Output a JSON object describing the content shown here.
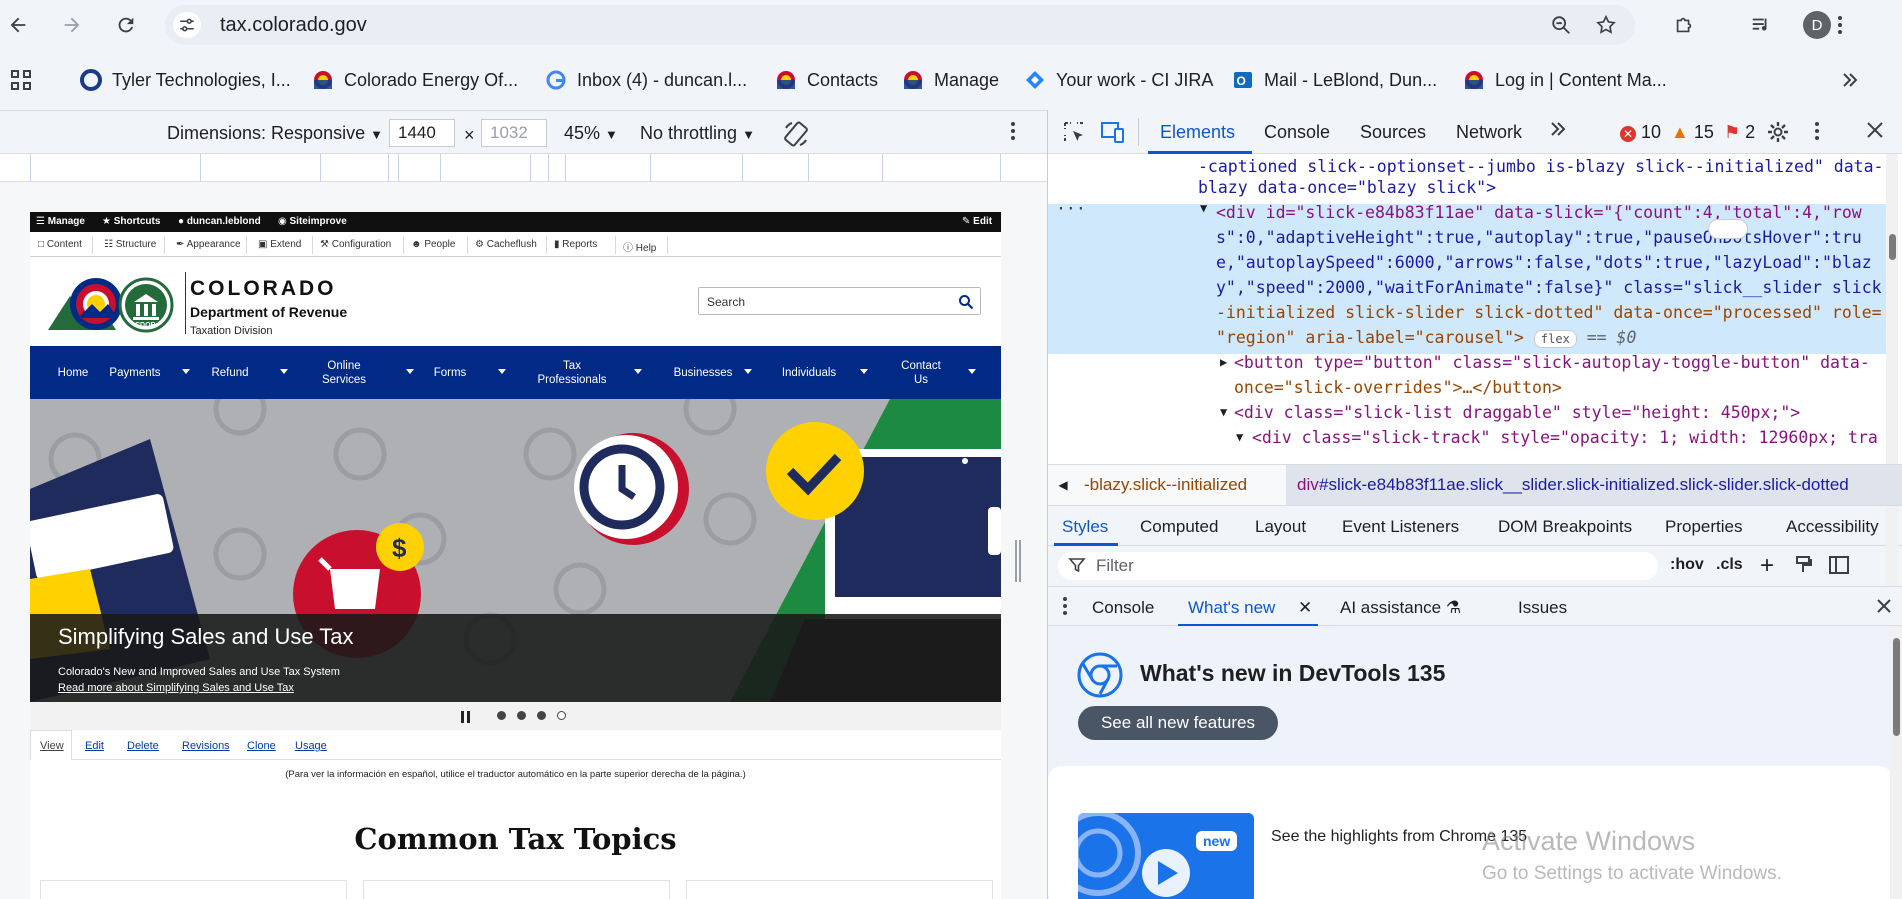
{
  "browser": {
    "url": "tax.colorado.gov",
    "avatar_letter": "D",
    "bookmarks": [
      {
        "label": "Tyler Technologies, I...",
        "icon": "tyler-favicon"
      },
      {
        "label": "Colorado Energy Of...",
        "icon": "colorado-favicon"
      },
      {
        "label": "Inbox (4) - duncan.l...",
        "icon": "google-favicon"
      },
      {
        "label": "Contacts",
        "icon": "colorado-favicon"
      },
      {
        "label": "Manage",
        "icon": "colorado-favicon"
      },
      {
        "label": "Your work - CI JIRA",
        "icon": "jira-favicon"
      },
      {
        "label": "Mail - LeBlond, Dun...",
        "icon": "outlook-favicon"
      },
      {
        "label": "Log in | Content Ma...",
        "icon": "colorado-favicon"
      }
    ]
  },
  "device_toolbar": {
    "dimensions_label": "Dimensions: Responsive",
    "width": "1440",
    "x_sep": "×",
    "height_placeholder": "1032",
    "zoom": "45%",
    "throttling": "No throttling"
  },
  "site": {
    "admin_bar": {
      "manage": "Manage",
      "shortcuts": "Shortcuts",
      "user": "duncan.leblond",
      "siteimprove": "Siteimprove",
      "edit": "Edit"
    },
    "admin_tools": [
      "Content",
      "Structure",
      "Appearance",
      "Extend",
      "Configuration",
      "People",
      "Cacheflush",
      "Reports",
      "Help"
    ],
    "header": {
      "state": "COLORADO",
      "department": "Department of Revenue",
      "division": "Taxation Division",
      "logo_badge": "CDOR",
      "search_placeholder": "Search"
    },
    "nav": [
      {
        "label": "Home",
        "has_caret": false
      },
      {
        "label": "Payments",
        "has_caret": true
      },
      {
        "label": "Refund",
        "has_caret": true
      },
      {
        "label": "Online Services",
        "has_caret": true
      },
      {
        "label": "Forms",
        "has_caret": true
      },
      {
        "label": "Tax Professionals",
        "has_caret": true
      },
      {
        "label": "Businesses",
        "has_caret": true
      },
      {
        "label": "Individuals",
        "has_caret": true
      },
      {
        "label": "Contact Us",
        "has_caret": true
      }
    ],
    "hero": {
      "title": "Simplifying Sales and Use Tax",
      "subtitle": "Colorado's New and Improved Sales and Use Tax System",
      "link": "Read more about Simplifying Sales and Use Tax",
      "slide_count": 4,
      "active_slide": 4
    },
    "page_tabs": [
      "View",
      "Edit",
      "Delete",
      "Revisions",
      "Clone",
      "Usage"
    ],
    "spanish_note": "(Para ver la información en español, utilice el traductor automático en la parte superior derecha de la página.)",
    "section_heading": "Common Tax Topics"
  },
  "devtools": {
    "tabs": [
      "Elements",
      "Console",
      "Sources",
      "Network"
    ],
    "active_tab": "Elements",
    "errors": "10",
    "warnings": "15",
    "issues": "2",
    "dom_lines": [
      {
        "indent": 0,
        "text": "-captioned slick--optionset--jumbo is-blazy slick--initialized\" data-"
      },
      {
        "indent": 0,
        "text": "blazy data-once=\"blazy slick\">"
      },
      {
        "indent": 1,
        "text": "<div id=\"slick-e84b83f11ae\" data-slick=\"{\"count\":4,\"total\":4,\"row"
      },
      {
        "indent": 1,
        "text": "s\":0,\"adaptiveHeight\":true,\"autoplay\":true,\"pauseOnDotsHover\":tru"
      },
      {
        "indent": 1,
        "text": "e,\"autoplaySpeed\":6000,\"arrows\":false,\"dots\":true,\"lazyLoad\":\"blaz"
      },
      {
        "indent": 1,
        "text": "y\",\"speed\":2000,\"waitForAnimate\":false}\" class=\"slick__slider slick"
      },
      {
        "indent": 1,
        "text": "-initialized slick-slider slick-dotted\" data-once=\"processed\" role="
      },
      {
        "indent": 1,
        "text": "\"region\" aria-label=\"carousel\">"
      },
      {
        "indent": 2,
        "text": "<button type=\"button\" class=\"slick-autoplay-toggle-button\" data-"
      },
      {
        "indent": 2,
        "text": "once=\"slick-overrides\">…</button>"
      },
      {
        "indent": 2,
        "text": "<div class=\"slick-list draggable\" style=\"height: 450px;\">"
      },
      {
        "indent": 3,
        "text": "<div class=\"slick-track\" style=\"opacity: 1; width: 12960px; tra"
      }
    ],
    "dom_flex_badge": "flex",
    "dom_eq": "== $0",
    "breadcrumb_left": "-blazy.slick--initialized",
    "breadcrumb_selected_tag": "div",
    "breadcrumb_selected": "#slick-e84b83f11ae.slick__slider.slick-initialized.slick-slider.slick-dotted",
    "style_tabs": [
      "Styles",
      "Computed",
      "Layout",
      "Event Listeners",
      "DOM Breakpoints",
      "Properties",
      "Accessibility"
    ],
    "filter_placeholder": "Filter",
    "hov": ":hov",
    "cls": ".cls",
    "drawer_tabs": [
      "Console",
      "What's new",
      "AI assistance",
      "Issues"
    ],
    "whats_new_title": "What's new in DevTools 135",
    "see_all_label": "See all new features",
    "new_badge": "new",
    "highlights_text": "See the highlights from Chrome 135"
  },
  "os_watermark": {
    "line1": "Activate Windows",
    "line2": "Go to Settings to activate Windows."
  }
}
